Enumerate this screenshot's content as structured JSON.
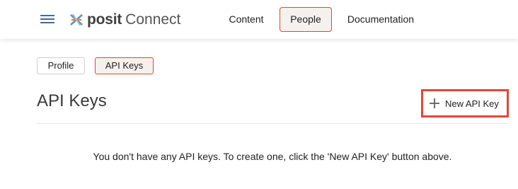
{
  "header": {
    "brand": "posit",
    "product": "Connect",
    "nav": {
      "content": "Content",
      "people": "People",
      "documentation": "Documentation"
    }
  },
  "subtabs": {
    "profile": "Profile",
    "api_keys": "API Keys"
  },
  "main": {
    "title": "API Keys",
    "new_key_button": "New API Key",
    "empty_message": "You don't have any API keys. To create one, click the 'New API Key' button above."
  },
  "colors": {
    "accent": "#e0473a",
    "active_bg": "#f4f1ee"
  }
}
